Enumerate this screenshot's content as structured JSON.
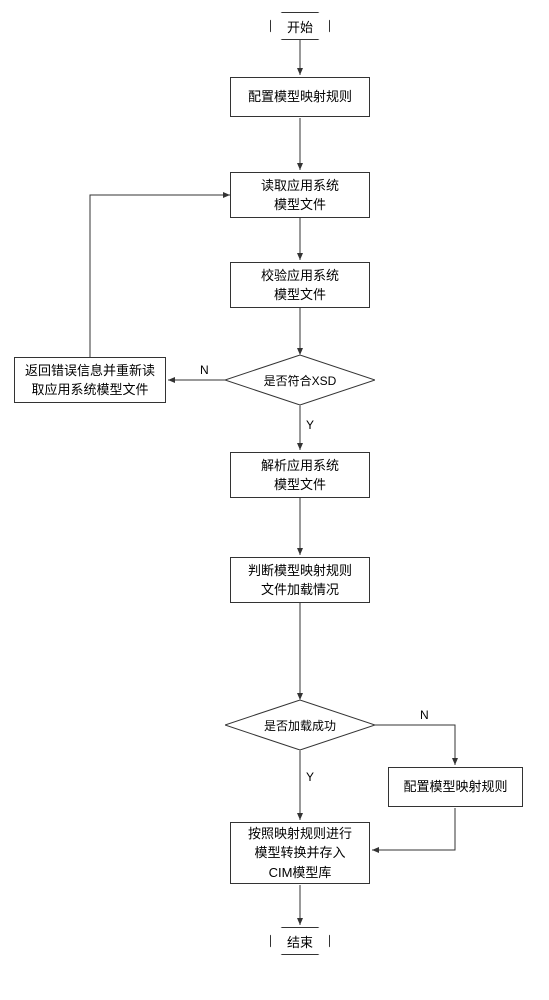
{
  "chart_data": {
    "type": "flowchart",
    "nodes": [
      {
        "id": "start",
        "type": "terminator",
        "label": "开始"
      },
      {
        "id": "p1",
        "type": "process",
        "label": "配置模型映射规则"
      },
      {
        "id": "p2",
        "type": "process",
        "label": "读取应用系统\n模型文件"
      },
      {
        "id": "p3",
        "type": "process",
        "label": "校验应用系统\n模型文件"
      },
      {
        "id": "d1",
        "type": "decision",
        "label": "是否符合XSD"
      },
      {
        "id": "p4",
        "type": "process",
        "label": "返回错误信息并重新读\n取应用系统模型文件"
      },
      {
        "id": "p5",
        "type": "process",
        "label": "解析应用系统\n模型文件"
      },
      {
        "id": "p6",
        "type": "process",
        "label": "判断模型映射规则\n文件加载情况"
      },
      {
        "id": "d2",
        "type": "decision",
        "label": "是否加载成功"
      },
      {
        "id": "p7",
        "type": "process",
        "label": "配置模型映射规则"
      },
      {
        "id": "p8",
        "type": "process",
        "label": "按照映射规则进行\n模型转换并存入\nCIM模型库"
      },
      {
        "id": "end",
        "type": "terminator",
        "label": "结束"
      }
    ],
    "edges": [
      {
        "from": "start",
        "to": "p1"
      },
      {
        "from": "p1",
        "to": "p2"
      },
      {
        "from": "p2",
        "to": "p3"
      },
      {
        "from": "p3",
        "to": "d1"
      },
      {
        "from": "d1",
        "to": "p5",
        "label": "Y"
      },
      {
        "from": "d1",
        "to": "p4",
        "label": "N"
      },
      {
        "from": "p4",
        "to": "p2"
      },
      {
        "from": "p5",
        "to": "p6"
      },
      {
        "from": "p6",
        "to": "d2"
      },
      {
        "from": "d2",
        "to": "p8",
        "label": "Y"
      },
      {
        "from": "d2",
        "to": "p7",
        "label": "N"
      },
      {
        "from": "p7",
        "to": "p8"
      },
      {
        "from": "p8",
        "to": "end"
      }
    ]
  },
  "labels": {
    "start": "开始",
    "p1": "配置模型映射规则",
    "p2_l1": "读取应用系统",
    "p2_l2": "模型文件",
    "p3_l1": "校验应用系统",
    "p3_l2": "模型文件",
    "d1": "是否符合XSD",
    "p4_l1": "返回错误信息并重新读",
    "p4_l2": "取应用系统模型文件",
    "p5_l1": "解析应用系统",
    "p5_l2": "模型文件",
    "p6_l1": "判断模型映射规则",
    "p6_l2": "文件加载情况",
    "d2": "是否加载成功",
    "p7": "配置模型映射规则",
    "p8_l1": "按照映射规则进行",
    "p8_l2": "模型转换并存入",
    "p8_l3": "CIM模型库",
    "end": "结束",
    "yes": "Y",
    "no": "N"
  }
}
